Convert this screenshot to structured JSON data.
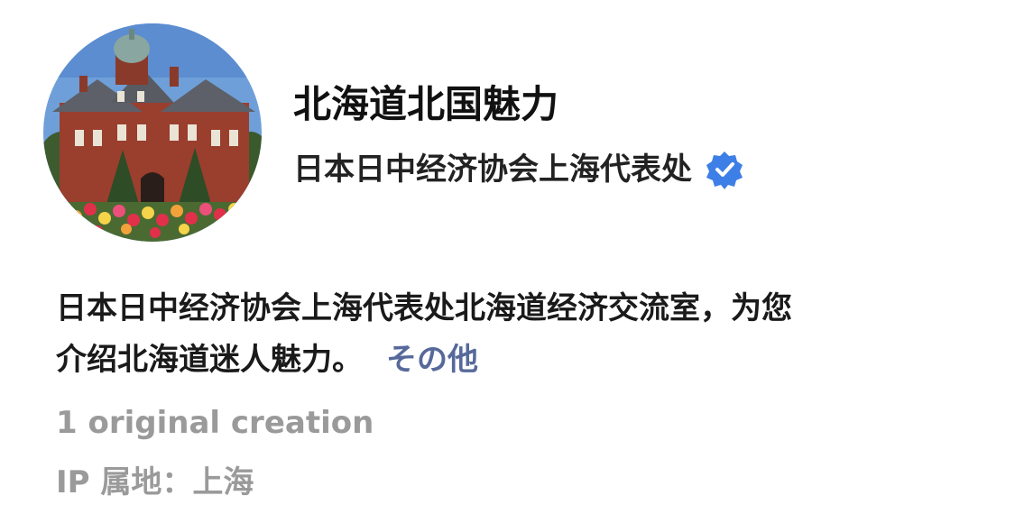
{
  "profile": {
    "account_name": "北海道北国魅力",
    "org_name": "日本日中经济协会上海代表处",
    "verified_icon": "verified-badge-icon",
    "verified_color": "#3d7fe6",
    "description_lines": [
      "日本日中经济协会上海代表处北海道经济交流室，为您",
      "介绍北海道迷人魅力。"
    ],
    "more_label": "その他",
    "original_count": "1 original creation",
    "ip_location": "IP 属地：上海"
  },
  "avatar": {
    "icon": "red-brick-government-building-photo"
  }
}
